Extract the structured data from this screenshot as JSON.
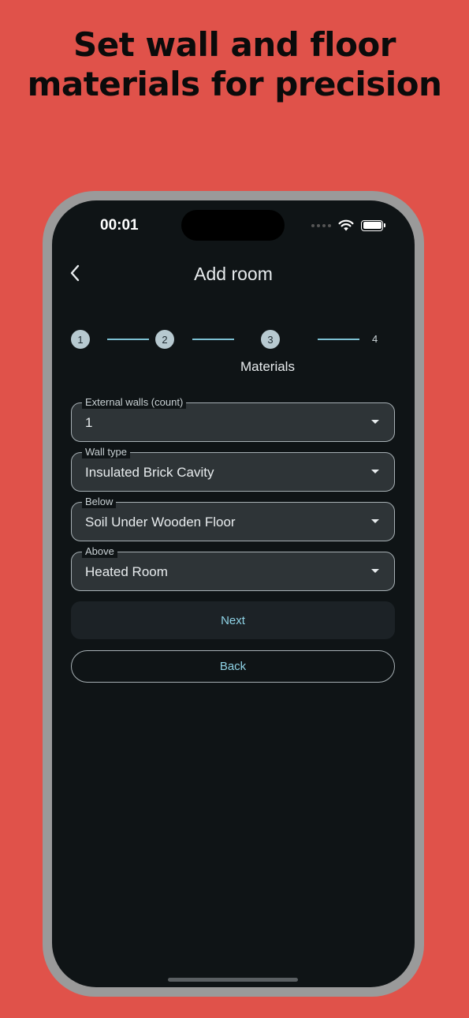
{
  "promo": {
    "line1": "Set wall and floor",
    "line2": "materials for precision"
  },
  "status_bar": {
    "time": "00:01"
  },
  "app_bar": {
    "title": "Add room"
  },
  "stepper": {
    "steps": [
      {
        "number": "1"
      },
      {
        "number": "2"
      },
      {
        "number": "3",
        "caption": "Materials"
      },
      {
        "number": "4"
      }
    ],
    "current_step": 3
  },
  "form": {
    "fields": [
      {
        "label": "External walls (count)",
        "value": "1"
      },
      {
        "label": "Wall type",
        "value": "Insulated Brick Cavity"
      },
      {
        "label": "Below",
        "value": "Soil Under Wooden Floor"
      },
      {
        "label": "Above",
        "value": "Heated Room"
      }
    ]
  },
  "buttons": {
    "next_label": "Next",
    "back_label": "Back"
  },
  "colors": {
    "background": "#E0524A",
    "screen": "#0f1416",
    "accent": "#8fd3e6",
    "step_line": "#7cc0d2"
  }
}
